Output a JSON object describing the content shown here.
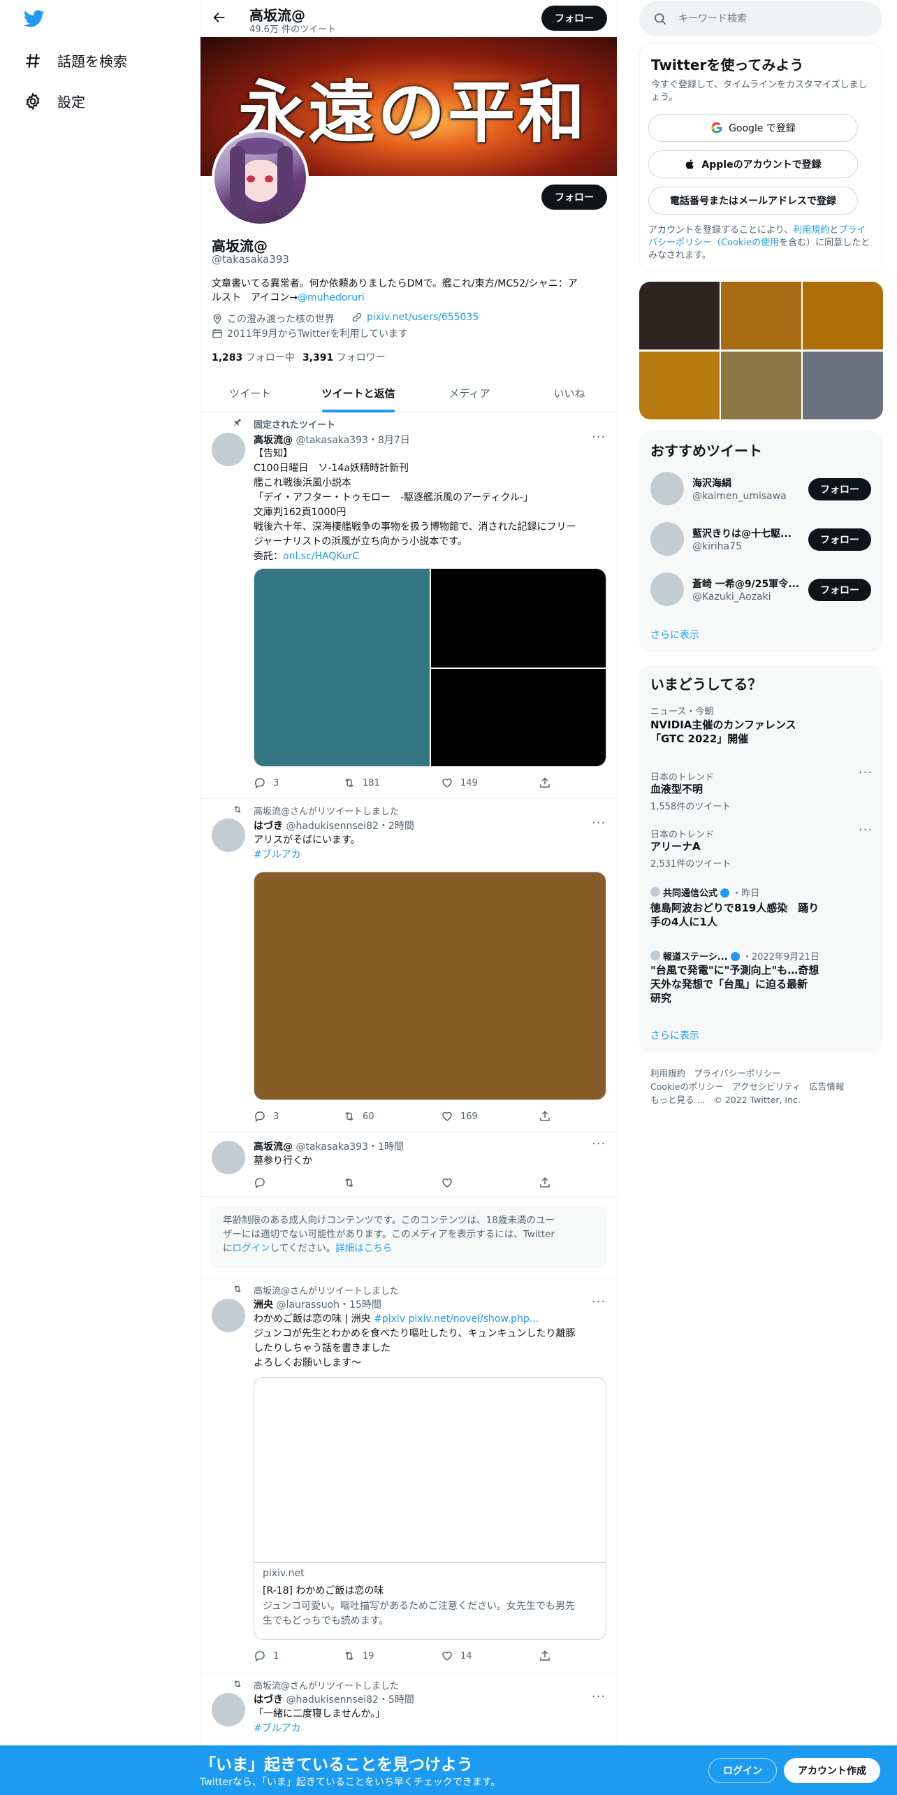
{
  "nav": {
    "explore_label": "話題を検索",
    "settings_label": "設定"
  },
  "header": {
    "name": "高坂流@",
    "tweet_count": "49.6万 件のツイート",
    "follow_label": "フォロー"
  },
  "banner": {
    "text": "永遠の平和"
  },
  "profile": {
    "follow_label": "フォロー",
    "name": "高坂流@",
    "handle": "@takasaka393",
    "bio_line1": "文章書いてる異常者。何か依頼ありましたらDMで。艦これ/東方/MC52/シャニ：ア",
    "bio_line2_prefix": "ルスト　アイコン→",
    "bio_link": "@muhedoruri",
    "location": "この澄み渡った核の世界",
    "website": "pixiv.net/users/655035",
    "joined": "2011年9月からTwitterを利用しています",
    "following_count": "1,283",
    "following_label": "フォロー中",
    "followers_count": "3,391",
    "followers_label": "フォロワー"
  },
  "tabs": [
    {
      "label": "ツイート"
    },
    {
      "label": "ツイートと返信"
    },
    {
      "label": "メディア"
    },
    {
      "label": "いいね"
    }
  ],
  "tweets": {
    "t1": {
      "pinned_label": "固定されたツイート",
      "name": "高坂流@",
      "meta": "@takasaka393・8月7日",
      "lines": [
        "【告知】",
        "C100日曜日　ソ-14a妖精時計新刊",
        "艦これ戦後浜風小説本",
        "「デイ・アフター・トゥモロー　-駆逐艦浜風のアーティクル-」",
        "文庫判162頁1000円",
        "戦後六十年、深海棲艦戦争の事物を扱う博物館で、消された記録にフリー",
        "ジャーナリストの浜風が立ち向かう小説本です。"
      ],
      "link_prefix": "委託：",
      "link": "onl.sc/HAQKurC",
      "replies": "3",
      "retweets": "181",
      "likes": "149",
      "image_colors": [
        "#357683",
        "#000000",
        "#000000"
      ]
    },
    "t2": {
      "retweet_label": "高坂流@さんがリツイートしました",
      "name": "はづき",
      "meta": "@hadukisennsei82・2時間",
      "text": "アリスがそばにいます。",
      "hashtag": "#ブルアカ",
      "replies": "3",
      "retweets": "60",
      "likes": "169",
      "image_color": "#875c28"
    },
    "t3": {
      "name": "高坂流@",
      "meta": "@takasaka393・1時間",
      "text": "墓参り行くか"
    },
    "warning": {
      "line1": "年齢制限のある成人向けコンテンツです。このコンテンツは、18歳未満のユー",
      "line2": "ザーには適切でない可能性があります。このメディアを表示するには、Twitter",
      "line3_prefix": "に",
      "login_link": "ログイン",
      "line3_mid": "してください。",
      "details_link": "詳細はこちら"
    },
    "t4": {
      "retweet_label": "高坂流@さんがリツイートしました",
      "name": "洲央",
      "meta": "@laurassuoh・15時間",
      "line1_text": "わかめご飯は恋の味 | 洲央 ",
      "line1_link": "#pixiv pixiv.net/novel/show.php...",
      "line2": "ジュンコが先生とわかめを食べたり嘔吐したり、キュンキュンしたり離豚",
      "line3": "したりしちゃう話を書きました",
      "line4": "よろしくお願いします～",
      "card_domain": "pixiv.net",
      "card_title": "[R-18] わかめご飯は恋の味",
      "card_desc1": "ジュンコ可愛い。嘔吐描写があるためご注意ください。女先生でも男先",
      "card_desc2": "生でもどっちでも読めます。",
      "replies": "1",
      "retweets": "19",
      "likes": "14"
    },
    "t5": {
      "retweet_label": "高坂流@さんがリツイートしました",
      "name": "はづき",
      "meta": "@hadukisennsei82・5時間",
      "text": "「一緒に二度寝しませんか。」",
      "hashtag": "#ブルアカ"
    }
  },
  "search": {
    "placeholder": "キーワード検索"
  },
  "signup": {
    "title": "Twitterを使ってみよう",
    "subtitle": "今すぐ登録して、タイムラインをカスタマイズしましょう。",
    "google": "Google で登録",
    "apple": "Appleのアカウントで登録",
    "phone": "電話番号またはメールアドレスで登録",
    "legal_prefix": "アカウントを登録することにより、",
    "legal_terms": "利用規約",
    "legal_and": "と",
    "legal_privacy": "プライバシーポリシー",
    "legal_cookie": "（Cookieの使用",
    "legal_suffix": "を含む）に同意したとみなされます。"
  },
  "media_grid": {
    "colors": [
      "#2e2523",
      "#a86a12",
      "#ad6e08",
      "#b67a10",
      "#8b7644",
      "#6c717e"
    ]
  },
  "who_to_follow": {
    "title": "おすすめツイート",
    "users": [
      {
        "name": "海沢海絹",
        "handle": "@kaimen_umisawa",
        "button": "フォロー"
      },
      {
        "name": "藍沢きりは@十七駆...",
        "handle": "@kiriha75",
        "button": "フォロー"
      },
      {
        "name": "蒼崎 一希@9/25軍令...",
        "handle": "@Kazuki_Aozaki",
        "button": "フォロー"
      }
    ],
    "show_more": "さらに表示"
  },
  "trends": {
    "title": "いまどうしてる？",
    "items": [
      {
        "context": "ニュース・今朝",
        "line1": "NVIDIA主催のカンファレンス",
        "line2": "「GTC 2022」開催",
        "count": ""
      },
      {
        "context": "日本のトレンド",
        "line1": "血液型不明",
        "line2": "",
        "count": "1,558件のツイート"
      },
      {
        "context": "日本のトレンド",
        "line1": "アリーナA",
        "line2": "",
        "count": "2,531件のツイート"
      },
      {
        "context": "共同通信公式",
        "context_suffix": "・昨日",
        "line1": "徳島阿波おどりで819人感染　踊り",
        "line2": "手の4人に1人",
        "count": ""
      },
      {
        "context": "報道ステーシ...",
        "context_suffix": "・2022年9月21日",
        "line1": "\"台風で発電\"に\"予測向上\"も…奇想",
        "line2": "天外な発想で「台風」に迫る最新",
        "line3": "研究",
        "count": ""
      }
    ],
    "show_more": "さらに表示"
  },
  "footer": {
    "terms": "利用規約",
    "privacy": "プライバシーポリシー",
    "cookie": "Cookieのポリシー",
    "accessibility": "アクセシビリティ",
    "ads": "広告情報",
    "more": "もっと見る ...",
    "copyright": "© 2022 Twitter, Inc."
  },
  "bottom_bar": {
    "title": "「いま」起きていることを見つけよう",
    "subtitle": "Twitterなら、「いま」起きていることをいち早くチェックできます。",
    "login": "ログイン",
    "signup": "アカウント作成"
  }
}
